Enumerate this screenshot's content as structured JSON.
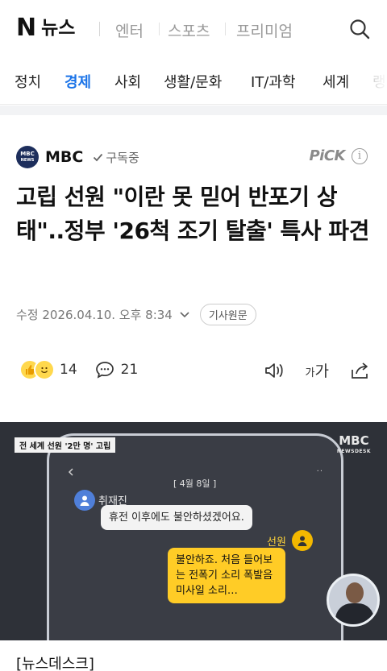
{
  "header": {
    "logo_n": "N",
    "logo_text": "뉴스",
    "nav": [
      "엔터",
      "스포츠",
      "프리미엄"
    ],
    "search_icon": "search-icon"
  },
  "categories": {
    "items": [
      "정치",
      "경제",
      "사회",
      "생활/문화",
      "IT/과학",
      "세계",
      "랭"
    ],
    "active": "경제",
    "active_color": "#1a73e8"
  },
  "article": {
    "press": {
      "logo_line1": "MBC",
      "logo_line2": "NEWS",
      "name": "MBC",
      "subscribe": "구독중"
    },
    "pick_label": "PiCK",
    "info_icon_glyph": "i",
    "headline": "고립 선원 \"이란 못 믿어 반포기 상태\"..정부 '26척 조기 탈출' 특사 파견",
    "timestamp": "수정 2026.04.10. 오후 8:34",
    "original_button": "기사원문",
    "reactions": {
      "like_count": "14",
      "comment_count": "21"
    },
    "font_small": "가",
    "font_large": "가"
  },
  "video": {
    "caption": "전 세계 선원 '2만 명' 고립",
    "brand": "MBC",
    "brand_sub": "NEWSDESK",
    "chat_date": "[ 4월 8일 ]",
    "sender_1": "취재진",
    "message_1": "휴전 이후에도 불안하셨겠어요.",
    "sender_2": "선원",
    "message_2": "불안하죠. 처음 들어보는 전폭기 소리 폭발음 미사일 소리…"
  },
  "source_label": "[뉴스데스크]"
}
